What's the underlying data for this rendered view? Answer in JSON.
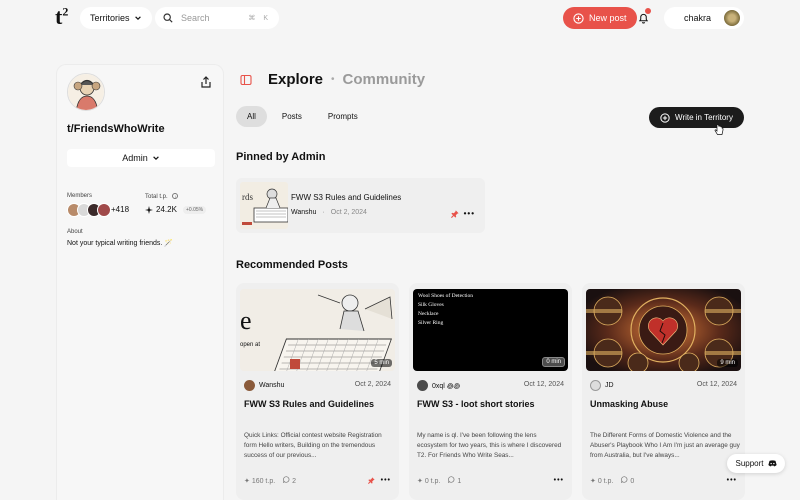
{
  "topbar": {
    "logo_text": "t",
    "logo_sup": "2",
    "territories_label": "Territories",
    "search_placeholder": "Search",
    "search_shortcut": "⌘ K",
    "new_post_label": "New post",
    "username": "chakra"
  },
  "sidebar": {
    "title": "t/FriendsWhoWrite",
    "admin_label": "Admin",
    "members_label": "Members",
    "members_extra": "+418",
    "total_tp_label": "Total t.p.",
    "total_tp_value": "24.2K",
    "total_tp_change": "+0.05%",
    "about_label": "About",
    "about_text": "Not your typical writing friends. 🪄"
  },
  "header": {
    "explore": "Explore",
    "separator": "•",
    "community": "Community"
  },
  "tabs": [
    {
      "label": "All",
      "active": true
    },
    {
      "label": "Posts",
      "active": false
    },
    {
      "label": "Prompts",
      "active": false
    }
  ],
  "write_button_label": "Write in Territory",
  "pinned": {
    "section_title": "Pinned by Admin",
    "title": "FWW S3 Rules and Guidelines",
    "author": "Wanshu",
    "separator": "·",
    "date": "Oct 2, 2024"
  },
  "recommended": {
    "section_title": "Recommended Posts",
    "cards": [
      {
        "author": "Wanshu",
        "date": "Oct 2, 2024",
        "read_time": "5 min",
        "title": "FWW S3 Rules and Guidelines",
        "excerpt": "Quick Links: Official contest website Registration form Hello writers, Building on the tremendous success of our previous...",
        "tp": "160 t.p.",
        "comments": "2",
        "pinned": true,
        "image_text": "e",
        "image_subtext": "open at"
      },
      {
        "author": "0xql ꩜꩜",
        "date": "Oct 12, 2024",
        "read_time": "0 min",
        "title": "FWW S3 - loot short stories",
        "excerpt": "My name is ql. I've been following the lens ecosystem for two years, this is where I discovered T2. For Friends Who Write Seas...",
        "tp": "0 t.p.",
        "comments": "1",
        "pinned": false,
        "image_lines": [
          "Wool Shoes of Detection",
          "Silk Gloves",
          "Necklace",
          "Silver Ring"
        ]
      },
      {
        "author": "JD",
        "date": "Oct 12, 2024",
        "read_time": "9 min",
        "title": "Unmasking Abuse",
        "excerpt": "The Different Forms of Domestic Violence and the Abuser's Playbook Who I Am I'm just an average guy from Australia, but I've always...",
        "tp": "0 t.p.",
        "comments": "0",
        "pinned": false
      }
    ]
  },
  "support_label": "Support",
  "colors": {
    "accent": "#e8524a",
    "dark_button": "#1c1c1c",
    "background": "#f5f5f5"
  }
}
